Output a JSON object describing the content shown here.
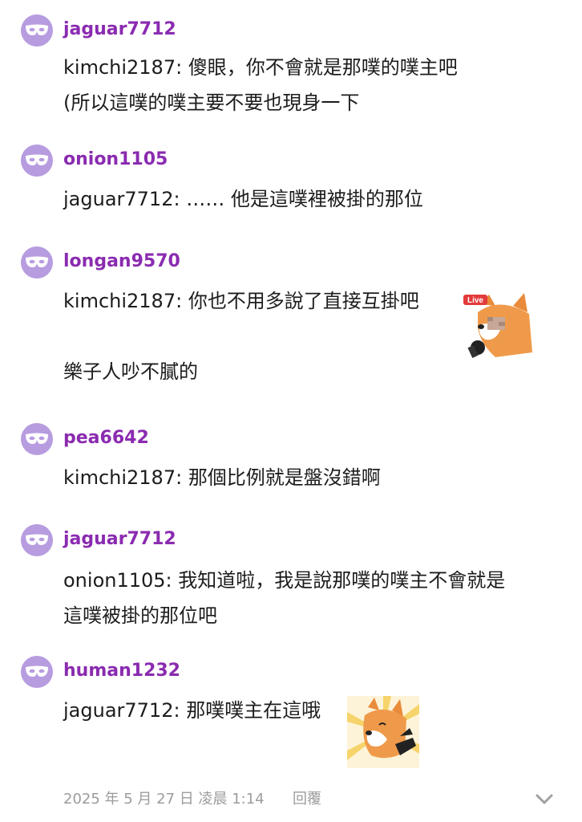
{
  "comments": [
    {
      "username": "jaguar7712",
      "lines": [
        "kimchi2187: 傻眼，你不會就是那噗的噗主吧",
        "(所以這噗的噗主要不要也現身一下"
      ]
    },
    {
      "username": "onion1105",
      "lines": [
        "jaguar7712: …… 他是這噗裡被掛的那位"
      ]
    },
    {
      "username": "longan9570",
      "lines": [
        "kimchi2187: 你也不用多說了直接互掛吧",
        "",
        "樂子人吵不膩的"
      ],
      "sticker_badge": "Live"
    },
    {
      "username": "pea6642",
      "lines": [
        "kimchi2187: 那個比例就是盤沒錯啊"
      ]
    },
    {
      "username": "jaguar7712",
      "lines": [
        "onion1105: 我知道啦，我是說那噗的噗主不會就是",
        "這噗被掛的那位吧"
      ]
    },
    {
      "username": "human1232",
      "lines": [
        "jaguar7712: 那噗噗主在這哦"
      ]
    }
  ],
  "footer": {
    "timestamp": "2025 年 5 月 27 日 凌晨 1:14",
    "reply_label": "回覆"
  },
  "icons": {
    "avatar": "mask-icon",
    "expand": "chevron-down-icon"
  },
  "colors": {
    "avatar_bg": "#b79ce0",
    "username": "#8a2bb0",
    "footer_text": "#9c9c9c"
  }
}
